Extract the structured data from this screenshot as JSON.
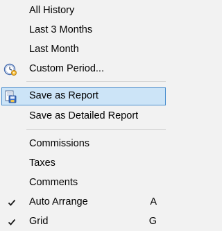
{
  "menu": {
    "items": [
      {
        "label": "All History"
      },
      {
        "label": "Last 3 Months"
      },
      {
        "label": "Last Month"
      },
      {
        "label": "Custom Period...",
        "icon": "clock-icon"
      },
      {
        "label": "Save as Report",
        "icon": "save-report-icon",
        "highlighted": true
      },
      {
        "label": "Save as Detailed Report"
      },
      {
        "label": "Commissions"
      },
      {
        "label": "Taxes"
      },
      {
        "label": "Comments"
      },
      {
        "label": "Auto Arrange",
        "checked": true,
        "shortcut": "A"
      },
      {
        "label": "Grid",
        "checked": true,
        "shortcut": "G"
      }
    ]
  },
  "colors": {
    "menu_background": "#f2f2f2",
    "highlight_background": "#cce4f7",
    "highlight_border": "#4b8fcf",
    "separator": "#d7d7d7",
    "text": "#000000"
  }
}
